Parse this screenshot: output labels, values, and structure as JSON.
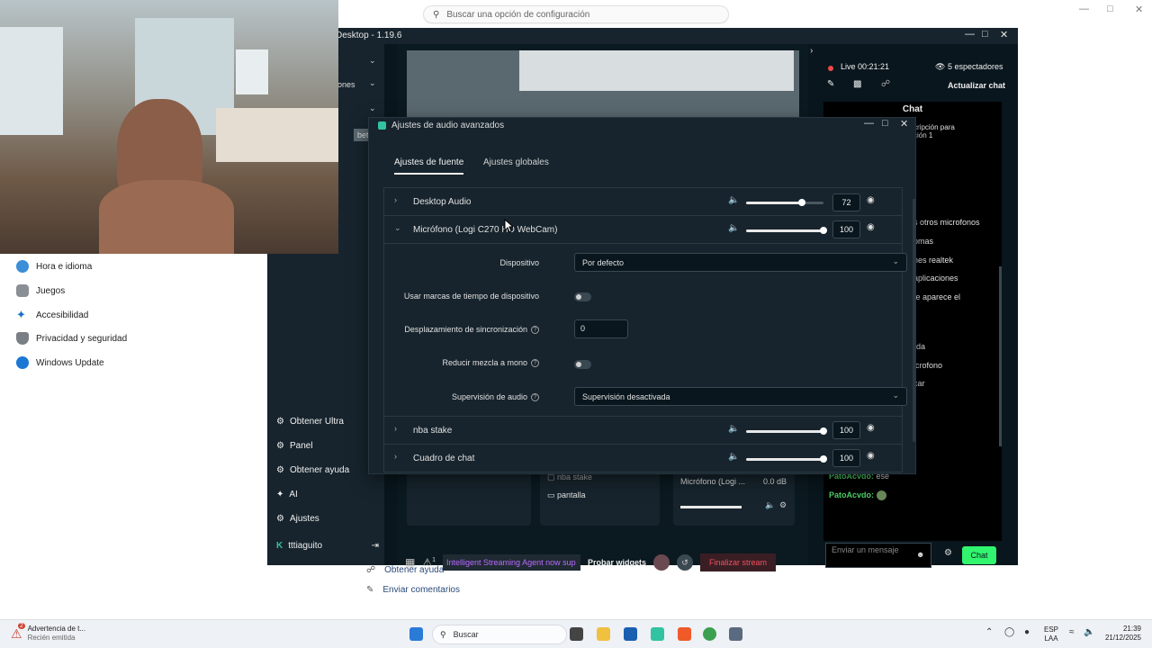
{
  "settings_bg": {
    "search_placeholder": "Buscar una opción de configuración",
    "nav": [
      "Hora e idioma",
      "Juegos",
      "Accesibilidad",
      "Privacidad y seguridad",
      "Windows Update"
    ],
    "bottom": [
      "Obtener ayuda",
      "Enviar comentarios"
    ]
  },
  "streamlabs": {
    "title": "Desktop - 1.19.6",
    "left_partial": "ones",
    "left_badge": "bet",
    "left_items": [
      "Obtener Ultra",
      "Panel",
      "Obtener ayuda",
      "AI",
      "Ajustes"
    ],
    "user": "tttiaguito",
    "live": "Live 00:21:21",
    "viewers": "5 espectadores",
    "update_chat": "Actualizar chat",
    "chat_title": "Chat",
    "chat_partial": [
      "cripción para",
      "ción 1",
      "s otros microfonos",
      "omas",
      "nes realtek",
      "aplicaciones",
      "te aparece el",
      "rda",
      "icrofono",
      "car"
    ],
    "chat_lines": [
      {
        "name": "PatoAcvdo:",
        "text": "ese"
      },
      {
        "name": "PatoAcvdo:",
        "text": ""
      }
    ],
    "chat_placeholder": "Enviar un mensaje",
    "chat_button": "Chat",
    "sources": [
      "nba stake",
      "pantalla"
    ],
    "mixer_label": "Micrófono (Logi ...",
    "mixer_db": "0.0 dB",
    "banner": "Intelligent Streaming Agent now sup",
    "test_widgets": "Probar widgets",
    "end_stream": "Finalizar stream",
    "alert_count": "1"
  },
  "dialog": {
    "title": "Ajustes de audio avanzados",
    "tabs": [
      "Ajustes de fuente",
      "Ajustes globales"
    ],
    "sources": [
      {
        "name": "Desktop Audio",
        "volume": "72",
        "level": 0.72
      },
      {
        "name": "Micrófono (Logi C270 HD WebCam)",
        "volume": "100",
        "level": 1.0
      },
      {
        "name": "nba stake",
        "volume": "100",
        "level": 1.0
      },
      {
        "name": "Cuadro de chat",
        "volume": "100",
        "level": 1.0
      }
    ],
    "settings": {
      "device_label": "Dispositivo",
      "device_value": "Por defecto",
      "timestamps_label": "Usar marcas de tiempo de dispositivo",
      "sync_label": "Desplazamiento de sincronización",
      "sync_value": "0",
      "mono_label": "Reducir mezcla a mono",
      "monitor_label": "Supervisión de audio",
      "monitor_value": "Supervisión desactivada"
    }
  },
  "taskbar": {
    "notif_title": "Advertencia de t...",
    "notif_sub": "Recién emitida",
    "notif_badge": "2",
    "search": "Buscar",
    "lang1": "ESP",
    "lang2": "LAA",
    "time": "21:39",
    "date": "21/12/2025"
  }
}
